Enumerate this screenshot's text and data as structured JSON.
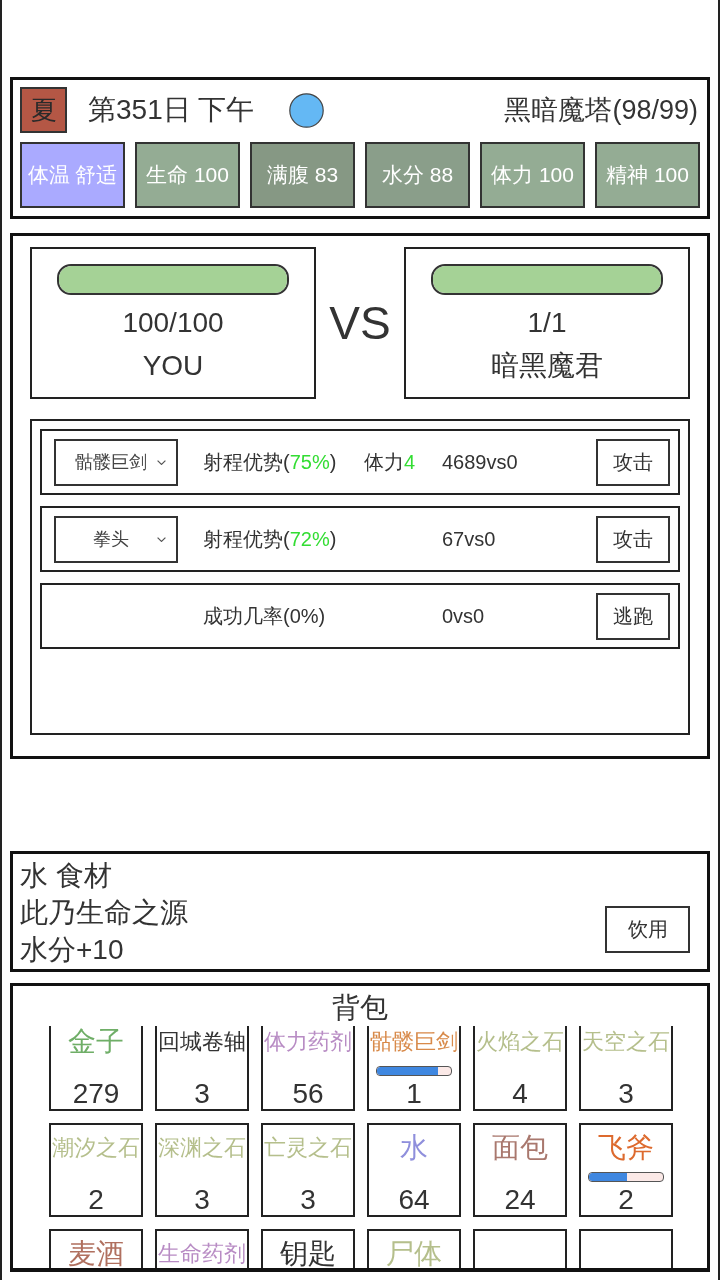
{
  "status": {
    "season": "夏",
    "date": "第351日 下午",
    "location": "黑暗魔塔(98/99)",
    "stats": [
      {
        "text": "体温 舒适",
        "color": "#aaaaff"
      },
      {
        "text": "生命 100",
        "color": "#94ac94"
      },
      {
        "text": "满腹 83",
        "color": "#869884"
      },
      {
        "text": "水分 88",
        "color": "#8a9e8a"
      },
      {
        "text": "体力 100",
        "color": "#94ac94"
      },
      {
        "text": "精神 100",
        "color": "#94ac94"
      }
    ]
  },
  "battle": {
    "fighters": [
      {
        "hp": "100/100",
        "name": "YOU",
        "level": 1
      },
      {
        "hp": "1/1",
        "name": "暗黑魔君",
        "level": 1
      }
    ],
    "versus": "VS",
    "actions": [
      {
        "kind": "attack",
        "weapon": "骷髅巨剑",
        "odds": [
          {
            "text": "射程优势(",
            "highlight": false
          },
          {
            "text": "75%",
            "highlight": true
          },
          {
            "text": ")",
            "highlight": false
          }
        ],
        "cost": [
          {
            "text": "体力",
            "highlight": false
          },
          {
            "text": "4",
            "highlight": true
          }
        ],
        "score": "4689vs0",
        "button": "攻击"
      },
      {
        "kind": "attack",
        "weapon": "拳头",
        "odds": [
          {
            "text": "射程优势(",
            "highlight": false
          },
          {
            "text": "72%",
            "highlight": true
          },
          {
            "text": ")",
            "highlight": false
          }
        ],
        "score": "67vs0",
        "button": "攻击"
      },
      {
        "kind": "flee",
        "odds": [
          {
            "text": "成功几率(0%)",
            "highlight": false
          }
        ],
        "score": "0vs0",
        "button": "逃跑"
      }
    ]
  },
  "item_info": {
    "lines": [
      "水 食材",
      "此乃生命之源",
      "水分+10"
    ],
    "button": "饮用"
  },
  "inventory": {
    "title": "背包",
    "items": [
      {
        "kind": "item",
        "name": "金子",
        "color": "#6fae67",
        "count": "279"
      },
      {
        "kind": "item",
        "name": "回城卷轴",
        "color": "#333333",
        "count": "3"
      },
      {
        "kind": "item",
        "name": "体力药剂",
        "color": "#b88cc4",
        "count": "56"
      },
      {
        "kind": "item",
        "name": "骷髅巨剑",
        "color": "#d88a4a",
        "count": "1",
        "level": 0.82
      },
      {
        "kind": "item",
        "name": "火焰之石",
        "color": "#b5bf8c",
        "count": "4"
      },
      {
        "kind": "item",
        "name": "天空之石",
        "color": "#b5bf8c",
        "count": "3"
      },
      {
        "kind": "item",
        "name": "潮汐之石",
        "color": "#b5bf8c",
        "count": "2"
      },
      {
        "kind": "item",
        "name": "深渊之石",
        "color": "#b5bf8c",
        "count": "3"
      },
      {
        "kind": "item",
        "name": "亡灵之石",
        "color": "#b5bf8c",
        "count": "3"
      },
      {
        "kind": "item",
        "name": "水",
        "color": "#8f8fdc",
        "count": "64"
      },
      {
        "kind": "item",
        "name": "面包",
        "color": "#a9786e",
        "count": "24"
      },
      {
        "kind": "item",
        "name": "飞斧",
        "color": "#dd6a2e",
        "count": "2",
        "level": 0.51
      },
      {
        "kind": "item",
        "name": "麦酒",
        "color": "#b0705f"
      },
      {
        "kind": "item",
        "name": "生命药剂",
        "color": "#b88cc4"
      },
      {
        "kind": "item",
        "name": "钥匙",
        "color": "#333333"
      },
      {
        "kind": "item",
        "name": "尸体",
        "color": "#b5bf8c"
      },
      {
        "kind": "empty"
      },
      {
        "kind": "empty"
      }
    ]
  }
}
